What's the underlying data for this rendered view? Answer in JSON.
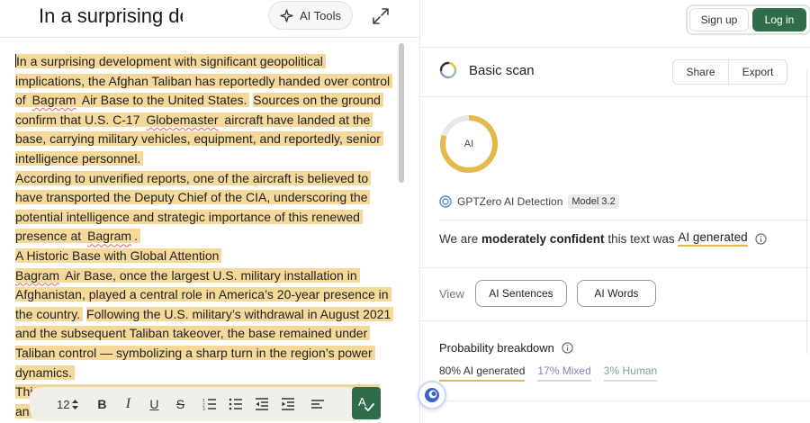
{
  "editor": {
    "title": "In a surprising development with significant geopolitical",
    "ai_tools_label": "AI Tools",
    "font_size": "12",
    "paragraphs": [
      [
        {
          "t": "In a surprising development with significant geopolitical implications, the Afghan Taliban has reportedly handed over control of ",
          "hl": true
        },
        {
          "t": "Bagram",
          "hl": true,
          "sp": true
        },
        {
          "t": " Air Base to the United States.",
          "hl": true
        },
        {
          "t": " ",
          "hl": false
        },
        {
          "t": "Sources on the ground confirm that U.S. C-17 ",
          "hl": true
        },
        {
          "t": "Globemaster",
          "hl": true,
          "sp": true
        },
        {
          "t": " aircraft have landed at the base, carrying military vehicles, equipment, and reportedly, senior intelligence personnel.",
          "hl": true
        }
      ],
      [
        {
          "t": "According to unverified reports, one of the aircraft is believed to have transported the Deputy Chief of the CIA, underscoring the potential intelligence and strategic importance of this renewed presence at ",
          "hl": true
        },
        {
          "t": "Bagram",
          "hl": true,
          "sp": true
        },
        {
          "t": ".",
          "hl": true
        }
      ],
      [
        {
          "t": "A Historic Base with Global Attention",
          "hl": true
        }
      ],
      [
        {
          "t": "Bagram",
          "hl": true,
          "sp": true
        },
        {
          "t": " Air Base, once the largest U.S. military installation in Afghanistan, played a central role in America’s 20-year presence in the country.",
          "hl": true
        },
        {
          "t": " ",
          "hl": false
        },
        {
          "t": "Following the U.S. military’s withdrawal in August 2021 and the subsequent Taliban takeover, the base remained under Taliban control — symbolizing a sharp turn in the region’s power dynamics.",
          "hl": true
        }
      ],
      [
        {
          "t": "This move raises significant questions about what led to this shift and its implications for the region",
          "hl": true
        }
      ]
    ]
  },
  "auth": {
    "signup": "Sign up",
    "login": "Log in"
  },
  "scan": {
    "title": "Basic scan",
    "share": "Share",
    "export": "Export",
    "ring_label": "AI",
    "ai_fraction": 0.8,
    "detector": "GPTZero AI Detection",
    "model": "Model 3.2",
    "verdict_pre": "We are ",
    "verdict_bold": "moderately confident",
    "verdict_mid": " this text was ",
    "verdict_ai": "AI generated",
    "view_label": "View",
    "view_sentences": "AI Sentences",
    "view_words": "AI Words",
    "prob_title": "Probability breakdown",
    "prob_ai": "80% AI generated",
    "prob_mixed": "17% Mixed",
    "prob_human": "3% Human"
  },
  "colors": {
    "accent_green": "#2f6d4a",
    "highlight": "#f5d99a",
    "ai_gold": "#e2b94a"
  }
}
